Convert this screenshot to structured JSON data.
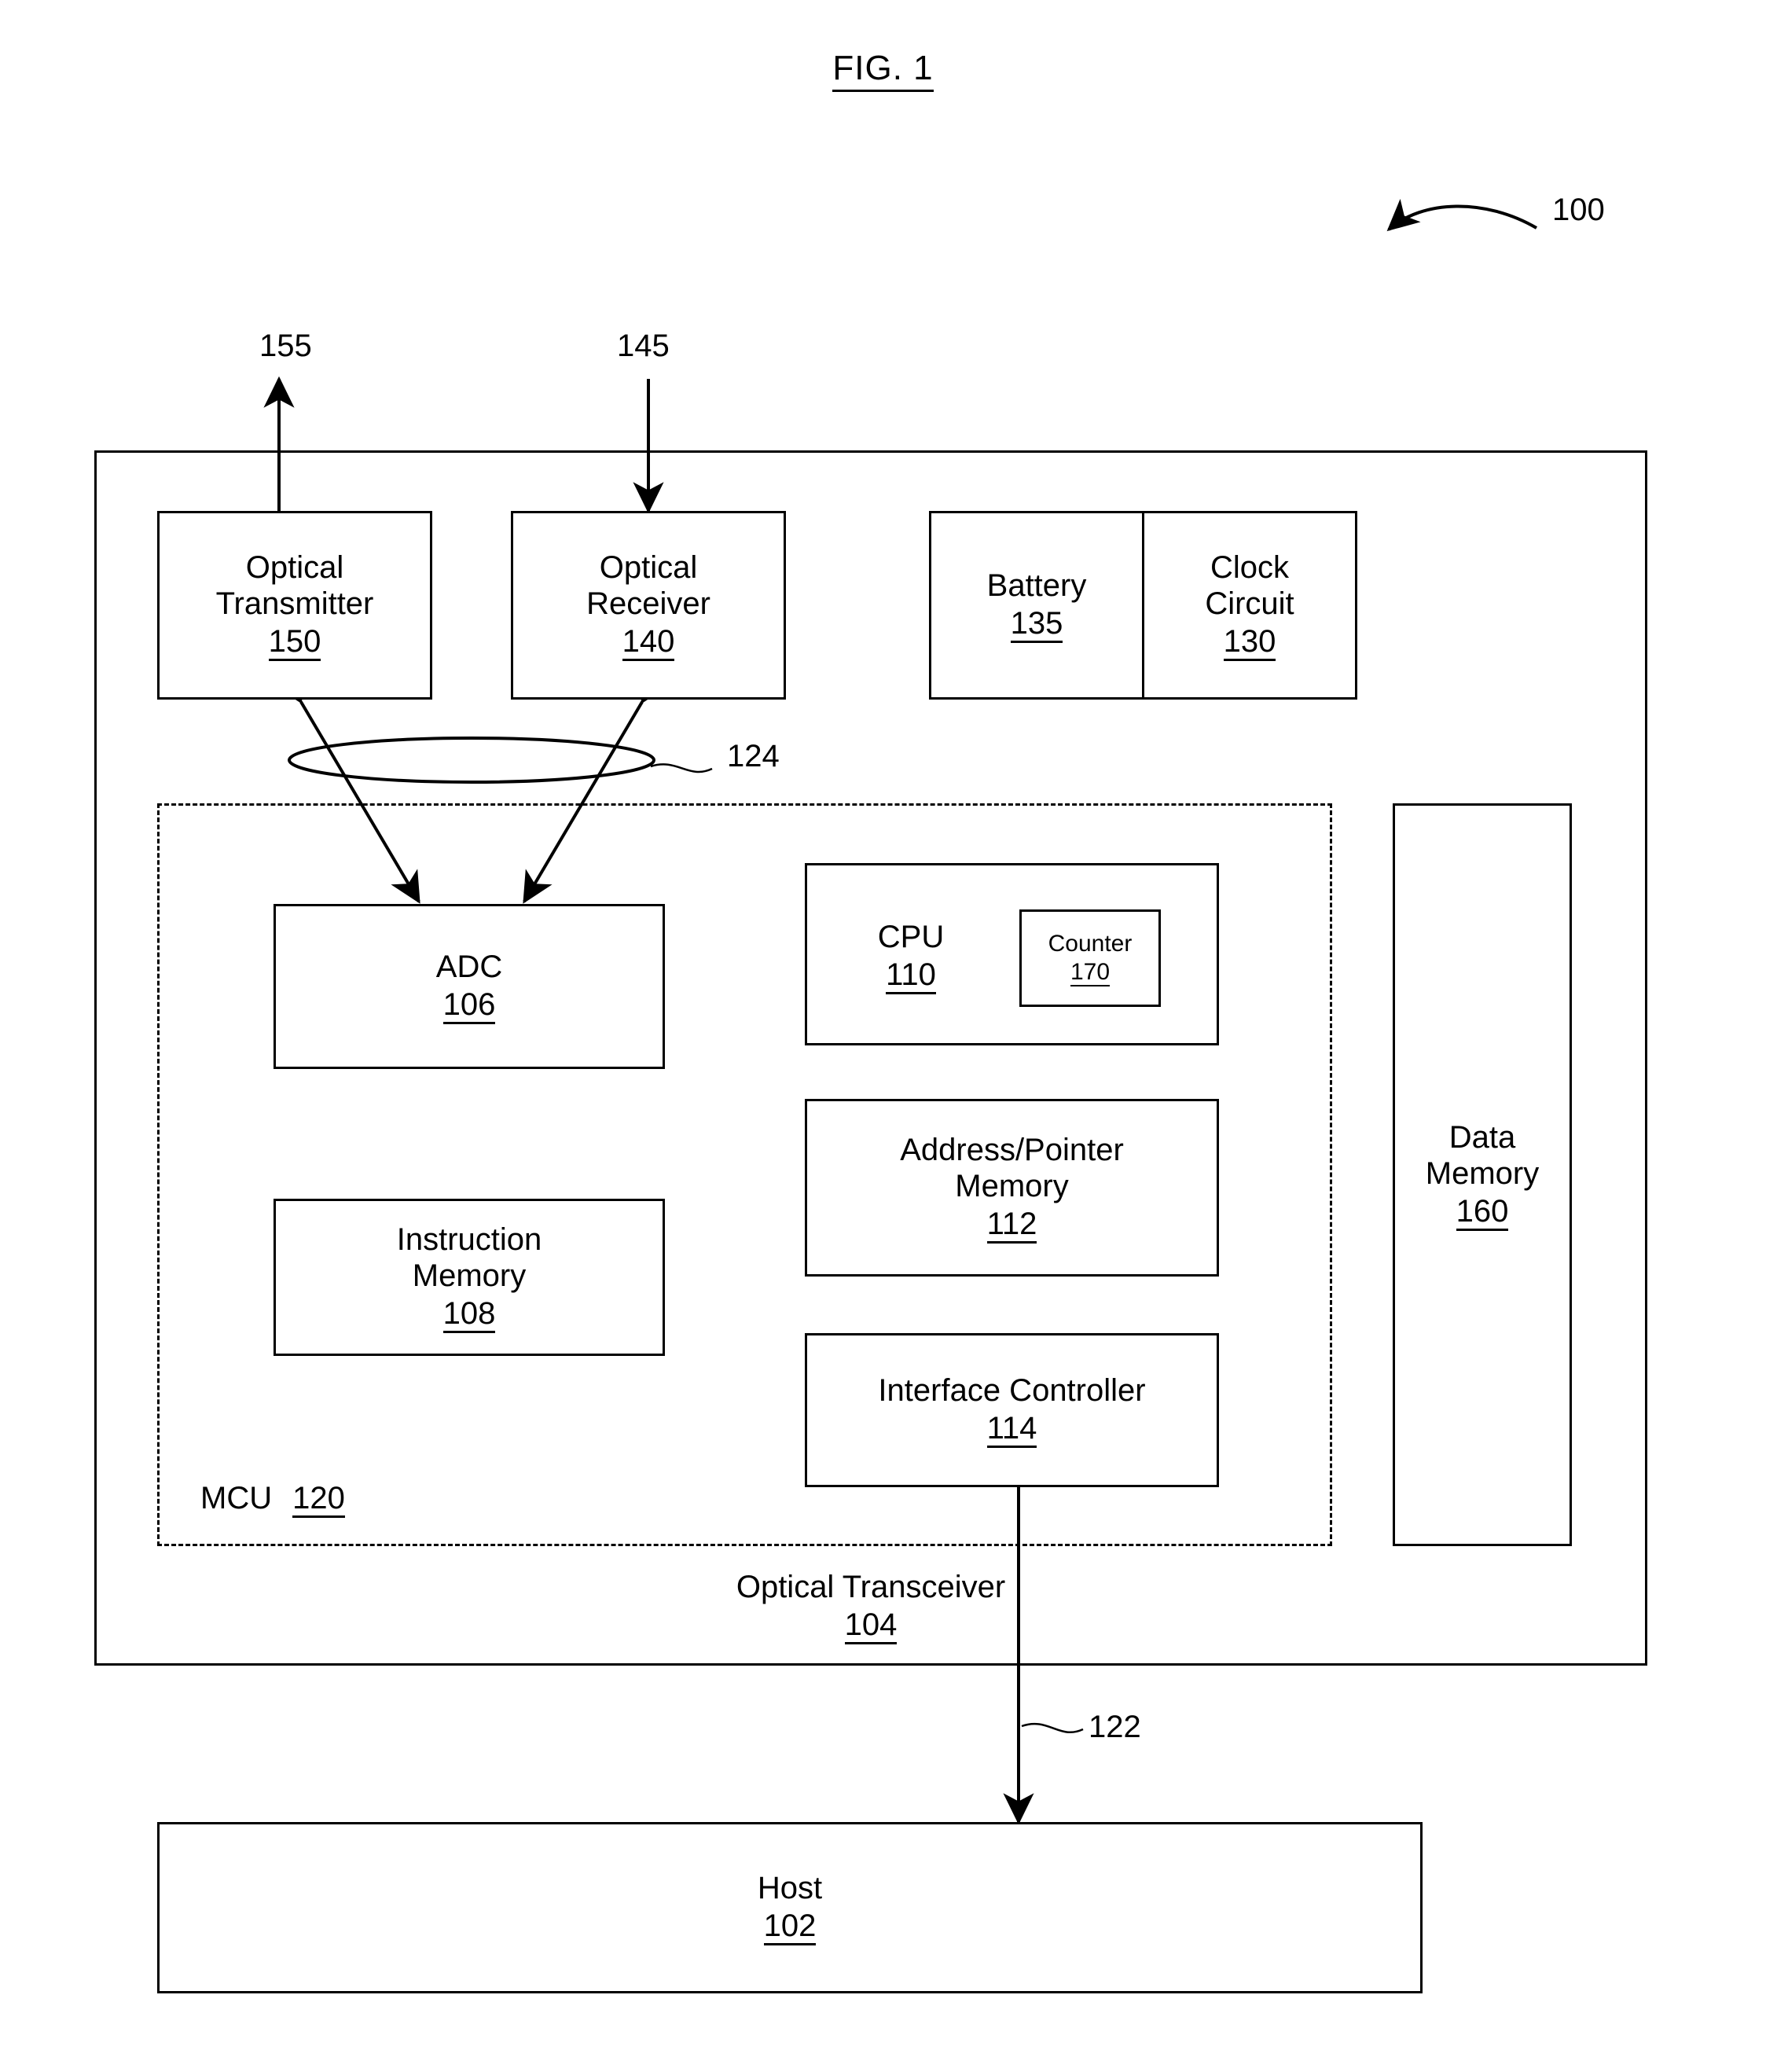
{
  "figure": {
    "title": "FIG. 1",
    "system_ref": "100"
  },
  "signals": {
    "transmit_out": "155",
    "receive_in": "145",
    "bus_internal": "124",
    "host_link": "122"
  },
  "transceiver": {
    "label": "Optical Transceiver",
    "ref": "104"
  },
  "mcu": {
    "label": "MCU",
    "ref": "120"
  },
  "blocks": {
    "optical_transmitter": {
      "line1": "Optical",
      "line2": "Transmitter",
      "ref": "150"
    },
    "optical_receiver": {
      "line1": "Optical",
      "line2": "Receiver",
      "ref": "140"
    },
    "battery": {
      "line1": "Battery",
      "ref": "135"
    },
    "clock_circuit": {
      "line1": "Clock",
      "line2": "Circuit",
      "ref": "130"
    },
    "adc": {
      "line1": "ADC",
      "ref": "106"
    },
    "instruction_memory": {
      "line1": "Instruction",
      "line2": "Memory",
      "ref": "108"
    },
    "cpu": {
      "line1": "CPU",
      "ref": "110"
    },
    "counter": {
      "line1": "Counter",
      "ref": "170"
    },
    "address_pointer_memory": {
      "line1": "Address/Pointer",
      "line2": "Memory",
      "ref": "112"
    },
    "interface_controller": {
      "line1": "Interface Controller",
      "ref": "114"
    },
    "data_memory": {
      "line1": "Data",
      "line2": "Memory",
      "ref": "160"
    },
    "host": {
      "line1": "Host",
      "ref": "102"
    }
  },
  "colors": {
    "ink": "#000000",
    "paper": "#ffffff"
  }
}
